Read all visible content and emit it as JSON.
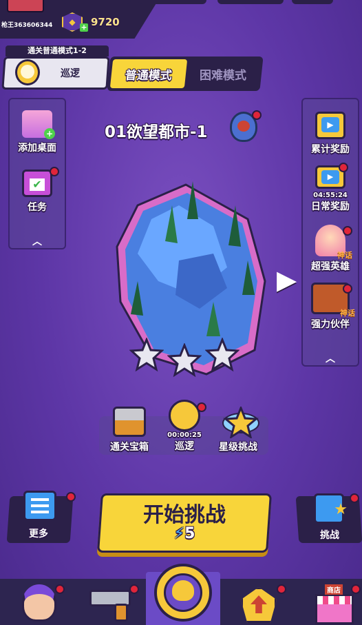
{
  "top": {
    "player_id": "枪王363606344",
    "gun_currency": "9720"
  },
  "mode": {
    "patrol_tag": "通关普通模式1-2",
    "patrol_label": "巡逻",
    "tab_normal": "普通模式",
    "tab_hard": "困难模式"
  },
  "left_panel": {
    "add_desktop": "添加桌面",
    "tasks": "任务",
    "collapse": "︿"
  },
  "right_panel": {
    "cumulative_reward": "累计奖励",
    "daily_timer": "04:55:24",
    "daily_reward": "日常奖励",
    "super_hero": "超强英雄",
    "strong_partner": "强力伙伴",
    "mythic_badge": "神话",
    "collapse": "︿"
  },
  "stage": {
    "title": "01欲望都市-1",
    "stars": 3
  },
  "rewards": {
    "chest": "通关宝箱",
    "patrol_timer": "00:00:25",
    "patrol": "巡逻",
    "star_challenge": "星级挑战"
  },
  "actions": {
    "more": "更多",
    "start": "开始挑战",
    "energy_cost": "5",
    "challenge": "挑战"
  },
  "nav": {
    "shop_tag": "商店"
  },
  "colors": {
    "accent_yellow": "#f8d53a",
    "bg_purple": "#5d36a6",
    "dark_panel": "#2b2048",
    "notify_red": "#e0253a"
  }
}
